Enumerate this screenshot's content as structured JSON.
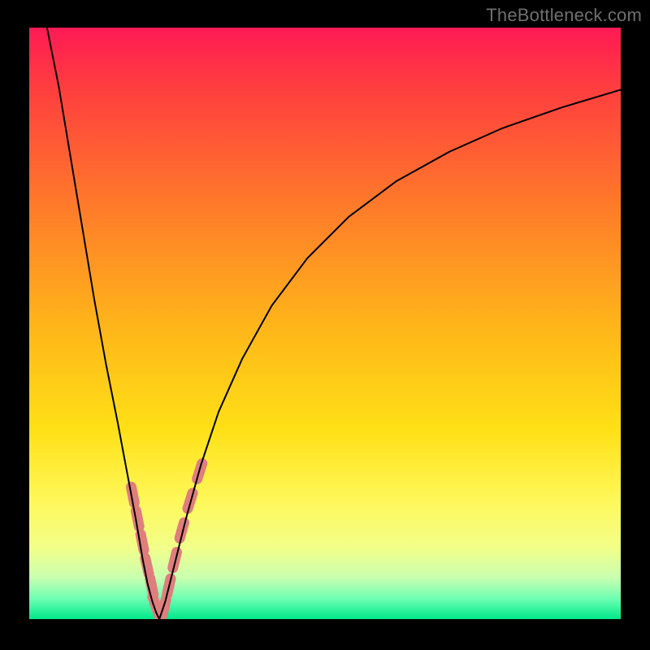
{
  "watermark": "TheBottleneck.com",
  "chart_data": {
    "type": "line",
    "title": "",
    "xlabel": "",
    "ylabel": "",
    "xlim": [
      0,
      100
    ],
    "ylim": [
      0,
      100
    ],
    "grid": false,
    "legend": false,
    "background_gradient_stops": [
      {
        "offset": 0.0,
        "color": "#ff1a55"
      },
      {
        "offset": 0.1,
        "color": "#ff3d3f"
      },
      {
        "offset": 0.3,
        "color": "#ff7a2a"
      },
      {
        "offset": 0.5,
        "color": "#ffb41a"
      },
      {
        "offset": 0.68,
        "color": "#ffe016"
      },
      {
        "offset": 0.8,
        "color": "#fff85a"
      },
      {
        "offset": 0.88,
        "color": "#f2ff8a"
      },
      {
        "offset": 0.93,
        "color": "#c9ffb0"
      },
      {
        "offset": 0.965,
        "color": "#6fffb3"
      },
      {
        "offset": 1.0,
        "color": "#00e88a"
      }
    ],
    "series": [
      {
        "name": "left-branch",
        "color": "#000000",
        "width": 2,
        "x": [
          3.0,
          5.0,
          7.0,
          9.0,
          11.0,
          13.0,
          15.0,
          16.5,
          18.0,
          19.2,
          20.0,
          20.8,
          21.5,
          22.0
        ],
        "y": [
          100.0,
          90.0,
          78.0,
          66.0,
          54.0,
          43.0,
          33.0,
          25.0,
          17.0,
          10.0,
          6.0,
          3.0,
          1.0,
          0.0
        ]
      },
      {
        "name": "right-branch",
        "color": "#000000",
        "width": 2,
        "x": [
          22.0,
          23.0,
          24.5,
          26.5,
          29.0,
          32.0,
          36.0,
          41.0,
          47.0,
          54.0,
          62.0,
          71.0,
          80.0,
          90.0,
          100.0
        ],
        "y": [
          0.0,
          3.0,
          9.0,
          17.0,
          26.0,
          35.0,
          44.0,
          53.0,
          61.0,
          68.0,
          74.0,
          79.0,
          83.0,
          86.5,
          89.5
        ]
      },
      {
        "name": "left-highlight-band",
        "type": "scatter",
        "color": "#e07d7d",
        "marker_width": 13,
        "x": [
          17.5,
          18.3,
          19.1,
          19.9,
          20.7,
          21.3,
          22.0
        ],
        "y": [
          21.0,
          17.0,
          13.0,
          9.0,
          5.5,
          2.5,
          0.5
        ]
      },
      {
        "name": "right-highlight-band",
        "type": "scatter",
        "color": "#e07d7d",
        "marker_width": 13,
        "x": [
          22.8,
          23.6,
          24.6,
          25.8,
          27.2,
          28.8
        ],
        "y": [
          2.0,
          5.5,
          10.0,
          15.0,
          20.0,
          25.0
        ]
      }
    ]
  }
}
